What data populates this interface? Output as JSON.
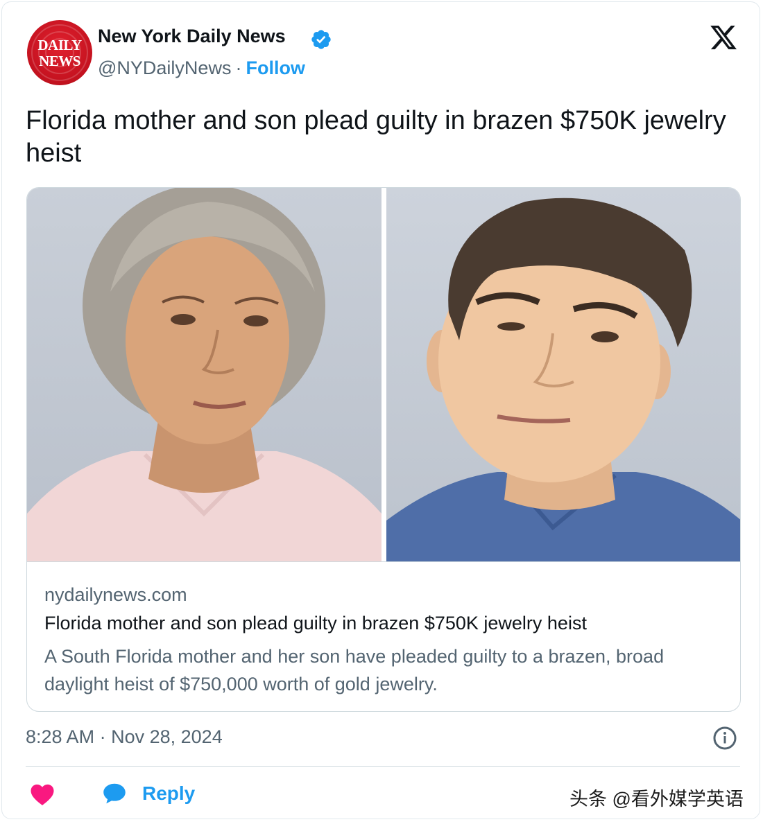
{
  "author": {
    "avatar_logo_lines": [
      "DAILY",
      "NEWS"
    ],
    "name": "New York Daily News",
    "handle": "@NYDailyNews",
    "separator": "·",
    "follow_label": "Follow",
    "verified": true
  },
  "tweet": {
    "text": "Florida mother and son plead guilty in brazen $750K jewelry heist"
  },
  "link_card": {
    "domain": "nydailynews.com",
    "title": "Florida mother and son plead guilty in brazen $750K jewelry heist",
    "description": "A South Florida mother and her son have pleaded guilty to a brazen, broad daylight heist of $750,000 worth of gold jewelry."
  },
  "footer": {
    "time": "8:28 AM",
    "separator": "·",
    "date": "Nov 28, 2024",
    "reply_label": "Reply"
  },
  "watermark": "头条 @看外媒学英语",
  "colors": {
    "accent": "#1d9bf0",
    "heart": "#f91880",
    "brand_red": "#c4121f",
    "secondary_text": "#536471"
  },
  "icons": [
    "verified-badge-icon",
    "x-logo-icon",
    "info-icon",
    "heart-icon",
    "reply-bubble-icon"
  ]
}
